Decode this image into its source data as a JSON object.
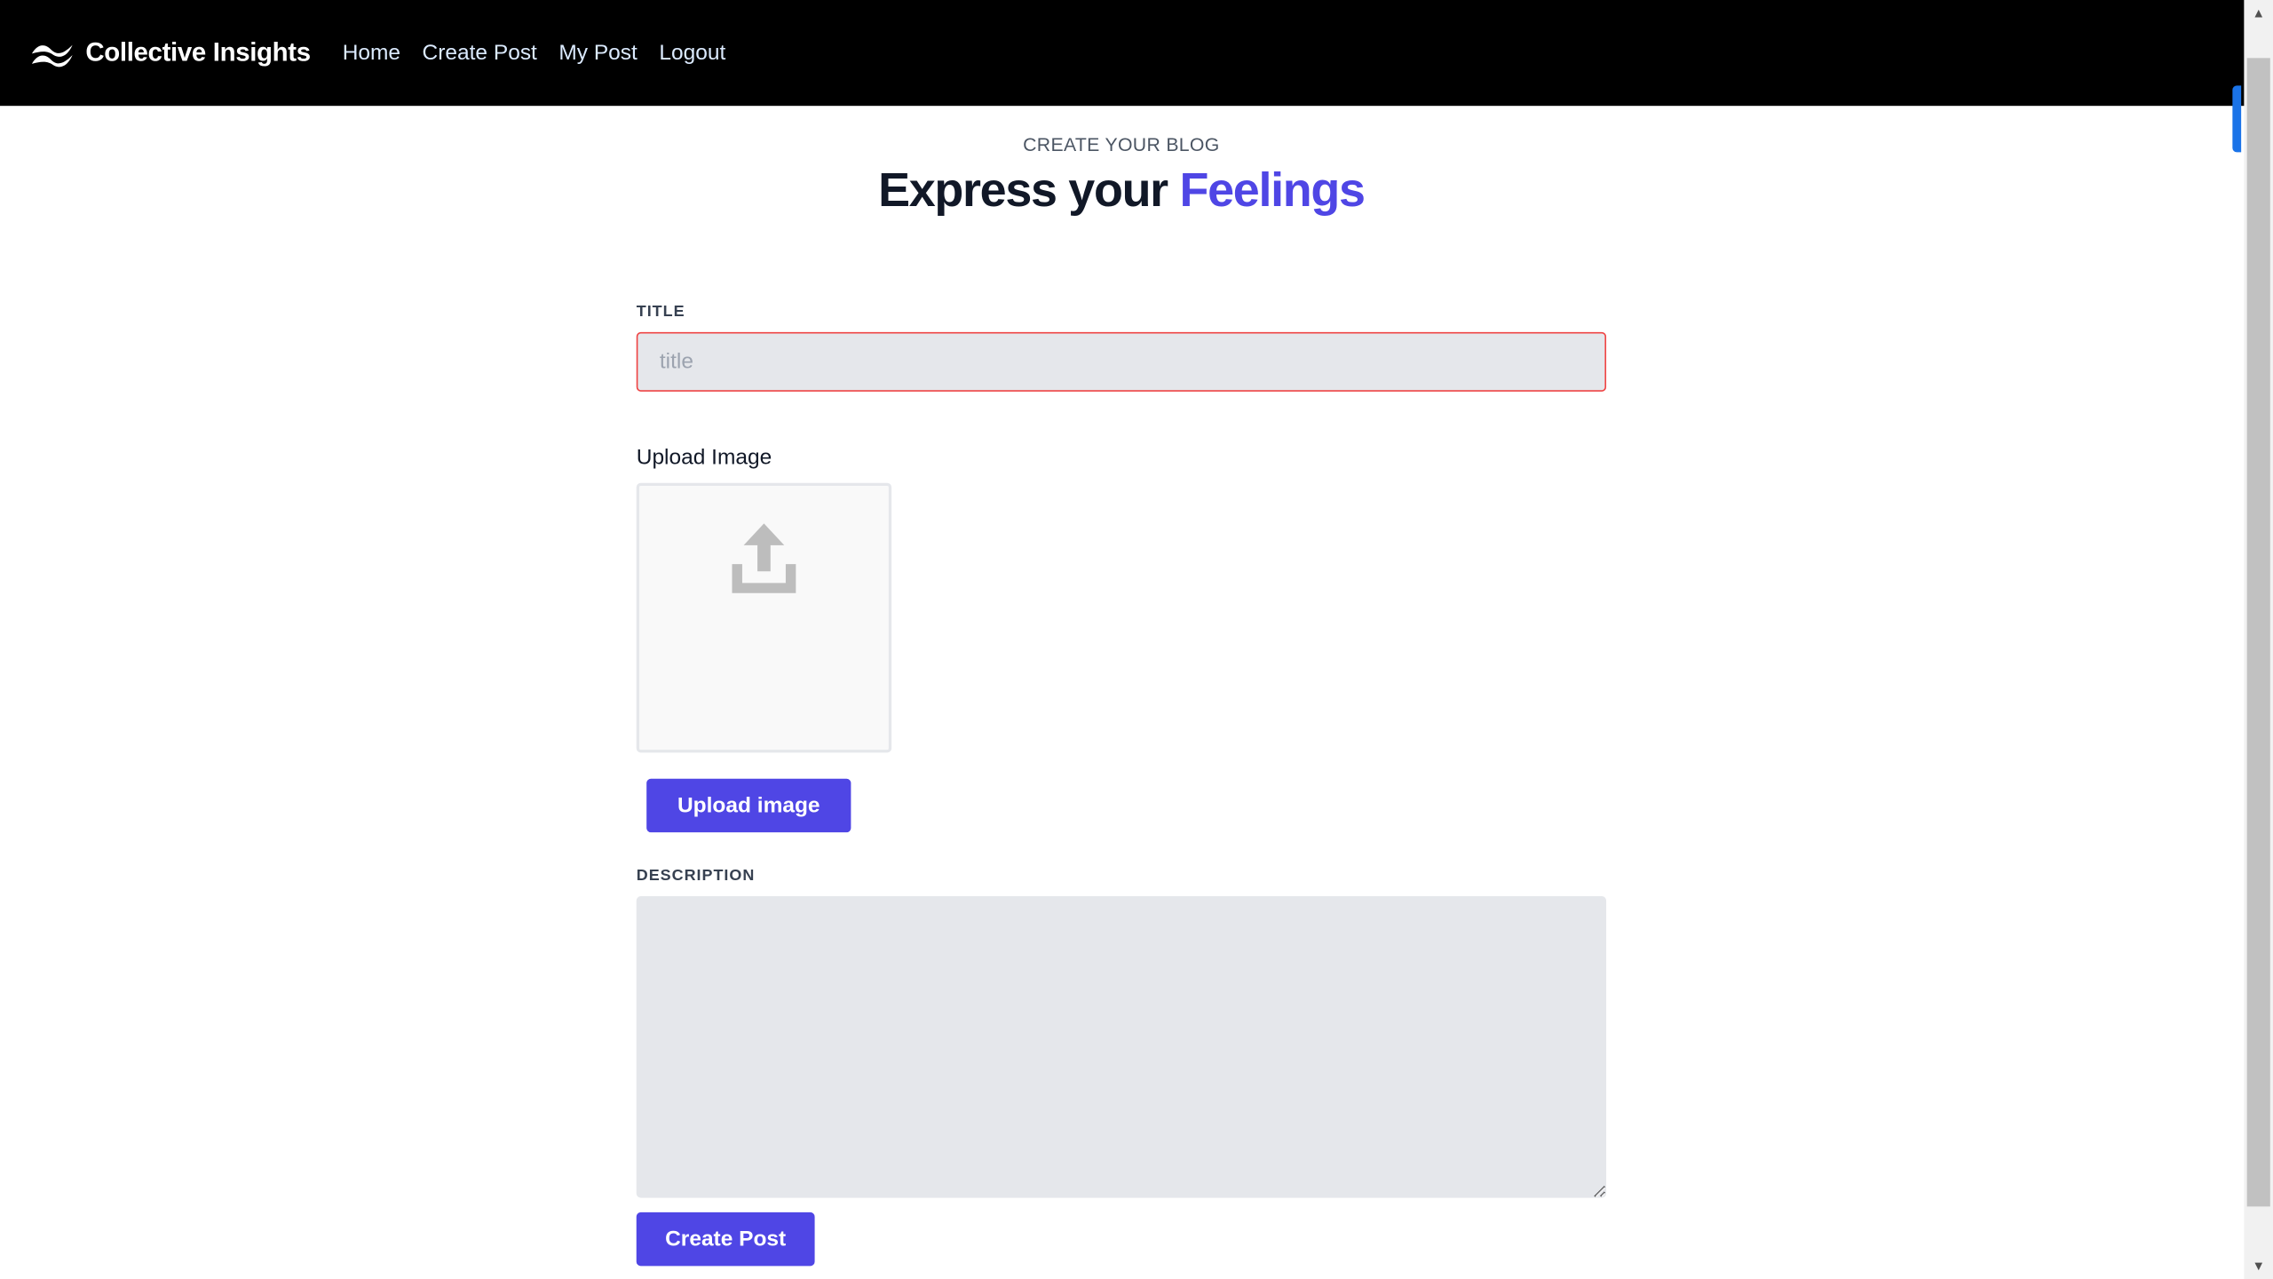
{
  "navbar": {
    "brand": "Collective Insights",
    "links": [
      "Home",
      "Create Post",
      "My Post",
      "Logout"
    ]
  },
  "header": {
    "eyebrow": "CREATE YOUR BLOG",
    "headline_main": "Express your",
    "headline_accent": "Feelings"
  },
  "form": {
    "title_label": "TITLE",
    "title_placeholder": "title",
    "title_value": "",
    "upload_label": "Upload Image",
    "upload_button": "Upload image",
    "description_label": "DESCRIPTION",
    "description_value": "",
    "submit_button": "Create Post"
  },
  "colors": {
    "accent": "#4f46e5",
    "navbar_bg": "#000000",
    "error_border": "#ef4444",
    "input_bg": "#e5e7eb"
  },
  "icons": [
    "wave-logo-icon",
    "upload-icon",
    "scroll-up-arrow-icon",
    "scroll-down-arrow-icon"
  ]
}
